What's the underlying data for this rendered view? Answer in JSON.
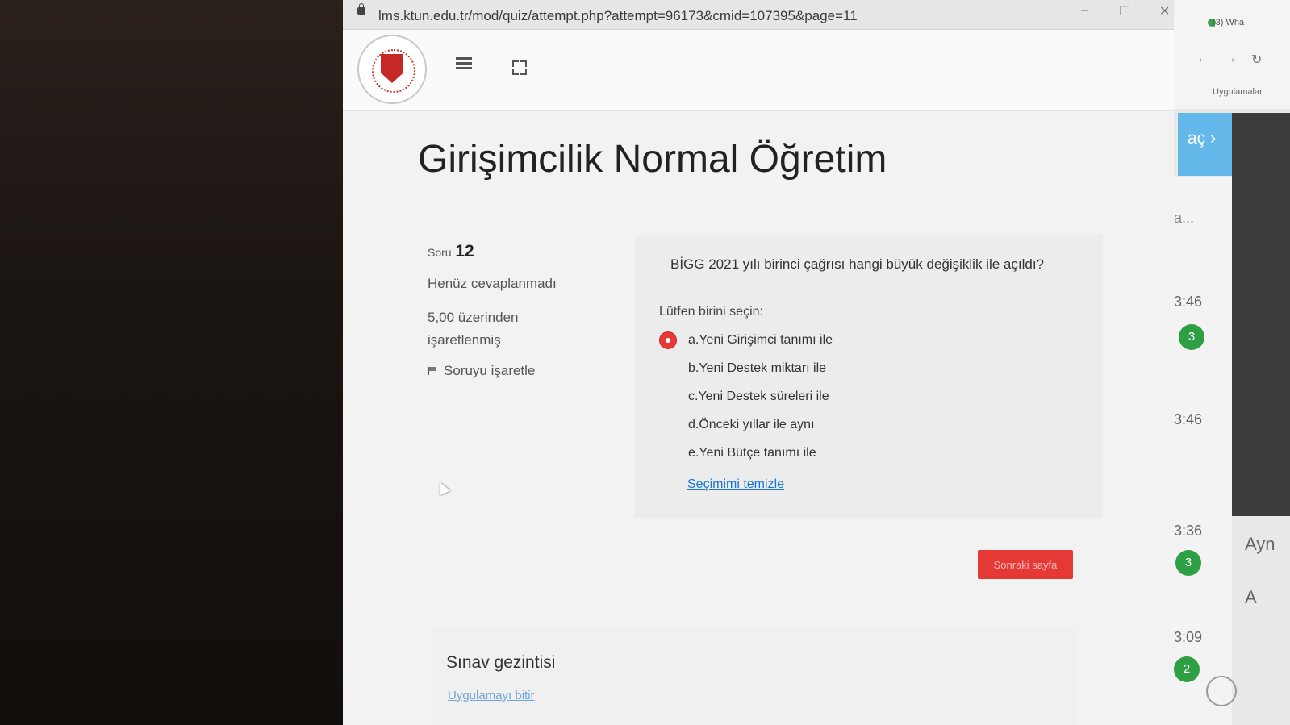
{
  "browser": {
    "url": "lms.ktun.edu.tr/mod/quiz/attempt.php?attempt=96173&cmid=107395&page=11",
    "window_controls": [
      "–",
      "☐",
      "✕"
    ]
  },
  "course": {
    "title": "Girişimcilik Normal Öğretim"
  },
  "question_info": {
    "label": "Soru",
    "number": "12",
    "status": "Henüz cevaplanmadı",
    "grade_line1": "5,00 üzerinden",
    "grade_line2": "işaretlenmiş",
    "flag_label": "Soruyu işaretle"
  },
  "question": {
    "text": "BİGG 2021 yılı birinci çağrısı hangi büyük değişiklik ile açıldı?",
    "prompt": "Lütfen birini seçin:",
    "options": [
      {
        "label": "a.Yeni Girişimci tanımı ile",
        "selected": true
      },
      {
        "label": "b.Yeni Destek miktarı ile",
        "selected": false
      },
      {
        "label": "c.Yeni Destek süreleri ile",
        "selected": false
      },
      {
        "label": "d.Önceki yıllar ile aynı",
        "selected": false
      },
      {
        "label": "e.Yeni Bütçe tanımı ile",
        "selected": false
      }
    ],
    "clear_label": "Seçimimi temizle"
  },
  "actions": {
    "next_label": "Sonraki sayfa"
  },
  "quiz_nav": {
    "title": "Sınav gezintisi",
    "finish_label": "Uygulamayı bitir"
  },
  "side_window": {
    "url_fragment": "(3) Wha",
    "apps_label": "Uygulamalar",
    "toggle_label": "aç ›",
    "chats": [
      {
        "time": "3:46",
        "badge": "3"
      },
      {
        "time": "3:46",
        "badge": ""
      },
      {
        "time": "3:36",
        "badge": "3"
      },
      {
        "time": "3:09",
        "badge": "2"
      }
    ],
    "ellipsis": "a...",
    "text_a": "Ayn",
    "text_b": "A"
  },
  "colors": {
    "accent_red": "#e53935",
    "link_blue": "#1976d2",
    "badge_green": "#2ea043",
    "toggle_blue": "#63b7e9"
  }
}
